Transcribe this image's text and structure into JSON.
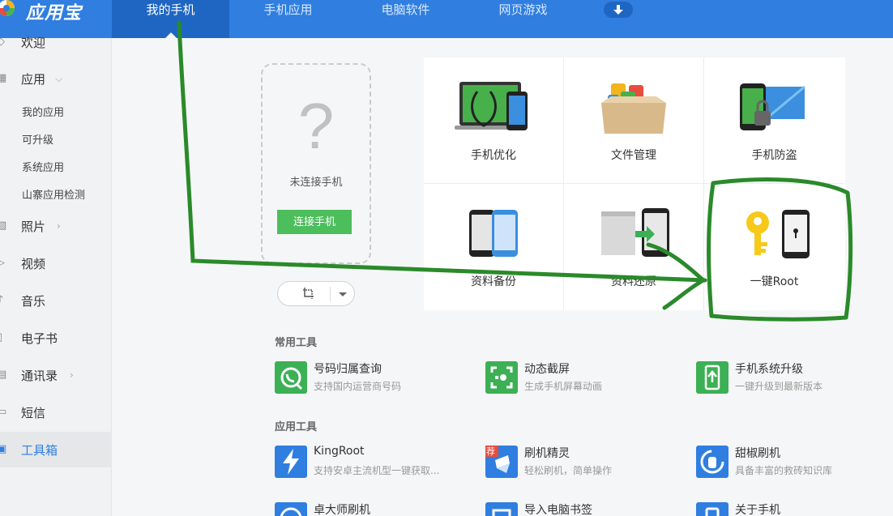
{
  "app": {
    "title": "应用宝"
  },
  "nav": {
    "tabs": [
      {
        "label": "我的手机"
      },
      {
        "label": "手机应用"
      },
      {
        "label": "电脑软件"
      },
      {
        "label": "网页游戏"
      }
    ]
  },
  "sidebar": {
    "items": [
      {
        "label": "欢迎",
        "icon": "welcome-icon"
      },
      {
        "label": "应用",
        "icon": "apps-grid-icon"
      },
      {
        "label": "照片",
        "icon": "photo-icon"
      },
      {
        "label": "视频",
        "icon": "video-icon"
      },
      {
        "label": "音乐",
        "icon": "music-icon"
      },
      {
        "label": "电子书",
        "icon": "ebook-icon"
      },
      {
        "label": "通讯录",
        "icon": "contacts-icon"
      },
      {
        "label": "短信",
        "icon": "sms-icon"
      },
      {
        "label": "工具箱",
        "icon": "toolbox-icon"
      }
    ],
    "sub_items": [
      "我的应用",
      "可升级",
      "系统应用",
      "山寨应用检测"
    ]
  },
  "phone": {
    "question_mark": "?",
    "status": "未连接手机",
    "connect_label": "连接手机"
  },
  "grid": {
    "cells": [
      {
        "label": "手机优化",
        "icon": "phone-optimize-icon"
      },
      {
        "label": "文件管理",
        "icon": "file-manage-icon"
      },
      {
        "label": "手机防盗",
        "icon": "anti-theft-icon"
      },
      {
        "label": "资料备份",
        "icon": "backup-icon"
      },
      {
        "label": "资料还原",
        "icon": "restore-icon"
      },
      {
        "label": "一键Root",
        "icon": "root-key-icon"
      }
    ]
  },
  "common_tools": {
    "title": "常用工具",
    "items": [
      {
        "name": "号码归属查询",
        "desc": "支持国内运营商号码",
        "icon": "phone-lookup-icon"
      },
      {
        "name": "动态截屏",
        "desc": "生成手机屏幕动画",
        "icon": "screen-capture-icon"
      },
      {
        "name": "手机系统升级",
        "desc": "一键升级到最新版本",
        "icon": "system-upgrade-icon"
      }
    ]
  },
  "app_tools": {
    "title": "应用工具",
    "items": [
      {
        "name": "KingRoot",
        "desc": "支持安卓主流机型一键获取...",
        "icon": "kingroot-icon"
      },
      {
        "name": "刷机精灵",
        "desc": "轻松刷机，简单操作",
        "icon": "flash-wizard-icon",
        "badge": "荐"
      },
      {
        "name": "甜椒刷机",
        "desc": "具备丰富的救砖知识库",
        "icon": "tianjiao-icon"
      },
      {
        "name": "卓大师刷机",
        "desc": "",
        "icon": "zhuodashi-icon"
      },
      {
        "name": "导入电脑书签",
        "desc": "",
        "icon": "bookmark-import-icon"
      },
      {
        "name": "关于手机",
        "desc": "",
        "icon": "about-phone-icon"
      }
    ]
  },
  "colors": {
    "primary": "#2f7ee0",
    "green": "#4cbe5c",
    "annotation": "#2a8a2a"
  }
}
